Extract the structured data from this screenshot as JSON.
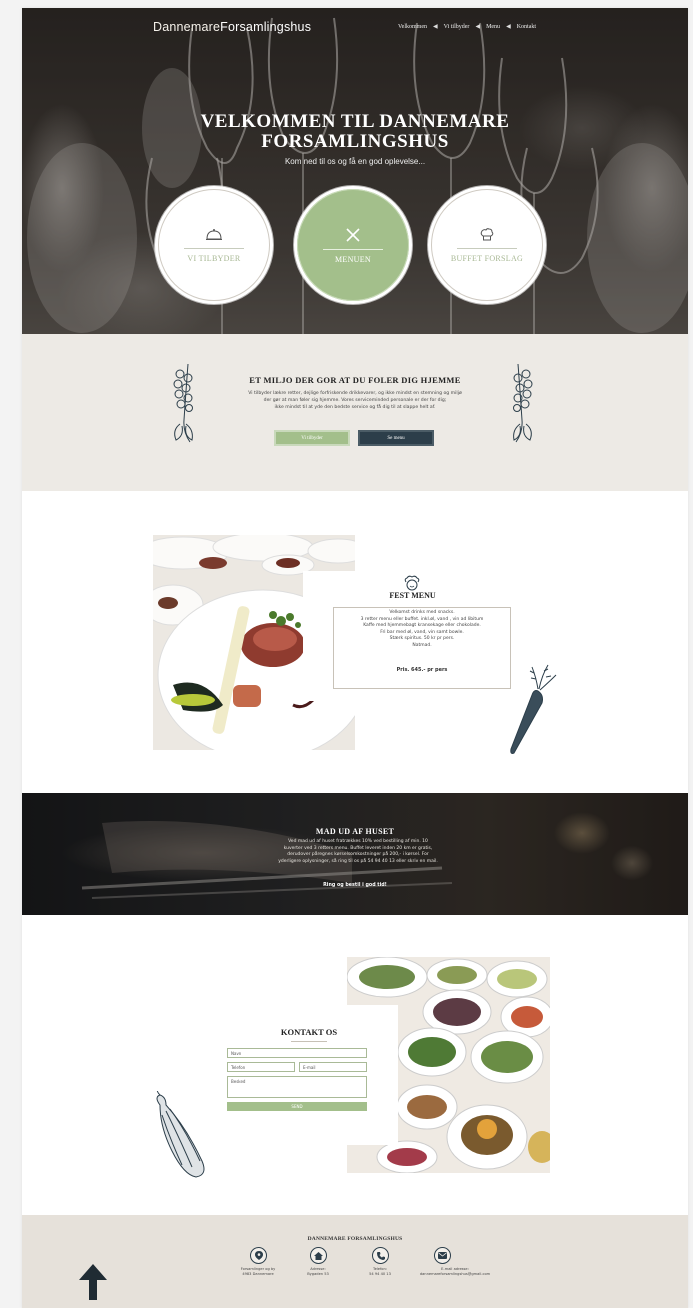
{
  "brand": {
    "part1": "Dannemare",
    "part2": "Forsamlingshus"
  },
  "nav": {
    "items": [
      "Velkommen",
      "Vi tilbyder",
      "Menu",
      "Kontakt"
    ],
    "separator": "◀"
  },
  "hero": {
    "title_line1": "VELKOMMEN TIL DANNEMARE",
    "title_line2": "FORSAMLINGSHUS",
    "subtitle": "Kom ned til os og få en god oplevelse...",
    "circles": [
      {
        "label": "VI TILBYDER",
        "icon": "cloche-icon"
      },
      {
        "label": "MENUEN",
        "icon": "fork-knife-icon"
      },
      {
        "label": "BUFFET FORSLAG",
        "icon": "chef-hat-icon"
      }
    ]
  },
  "miljo": {
    "title": "ET MILJO DER GOR AT DU FOLER DIG HJEMME",
    "line1": "Vi tilbyder lækre retter, dejlige forfriskende drikkevarer, og ikke mindst en stemning og miljø",
    "line2": "der gør at man føler sig hjemme. Vores serviceminded personale er der for dig;",
    "line3": "ikke mindst til at yde den bedste service og få dig til at slappe helt af.",
    "btn_green": "Vi tilbyder",
    "btn_dark": "Se menu"
  },
  "fest": {
    "title": "FEST MENU",
    "lines": [
      "Velkomst drinks med snacks.",
      "3 retter menu eller buffet. inkl.øl, vand , vin ad libitum",
      "Kaffe med hjemmebagt kransekage eller chokolade.",
      "Fri bar med øl, vand, vin samt bowle.",
      "Stærk spiritus. 50 kr pr pers.",
      "Natmad."
    ],
    "price": "Pris. 645.- pr pers"
  },
  "madud": {
    "title": "MAD UD AF HUSET",
    "lines": [
      "Ved mad ud af huset fratrækkes 10% ved bestilling af min. 10",
      "kuverter ved 3 retters menu. Buffet leveret inden 20 km er gratis,",
      "derudover påregnes kørselsomkostninger på 200,- i kørsel. For",
      "yderligere oplysninger, så ring til os på 54 94 40 13 eller skriv en mail."
    ],
    "cta": "Ring og bestil i god tid!"
  },
  "kontakt": {
    "title": "KONTAKT OS",
    "name_placeholder": "Navn",
    "phone_placeholder": "Telefon",
    "email_placeholder": "E-mail",
    "message_placeholder": "Besked",
    "send_label": "SEND"
  },
  "footer": {
    "title": "DANNEMARE FORSAMLINGSHUS",
    "items": [
      {
        "icon": "location-pin-icon",
        "line1": "Forsamlinger og by",
        "line2": "4983 Dannemare"
      },
      {
        "icon": "home-icon",
        "line1": "Adresse:",
        "line2": "Bygaden 53"
      },
      {
        "icon": "phone-icon",
        "line1": "Telefon:",
        "line2": "54 94 40 13"
      },
      {
        "icon": "email-icon",
        "line1": "E-mail adresse:",
        "line2": "dannemareforsamlingshus@gmail.com"
      }
    ]
  },
  "colors": {
    "accent_green": "#a3bf8b",
    "dark_navy": "#2c3e4a",
    "beige": "#edeae5"
  }
}
